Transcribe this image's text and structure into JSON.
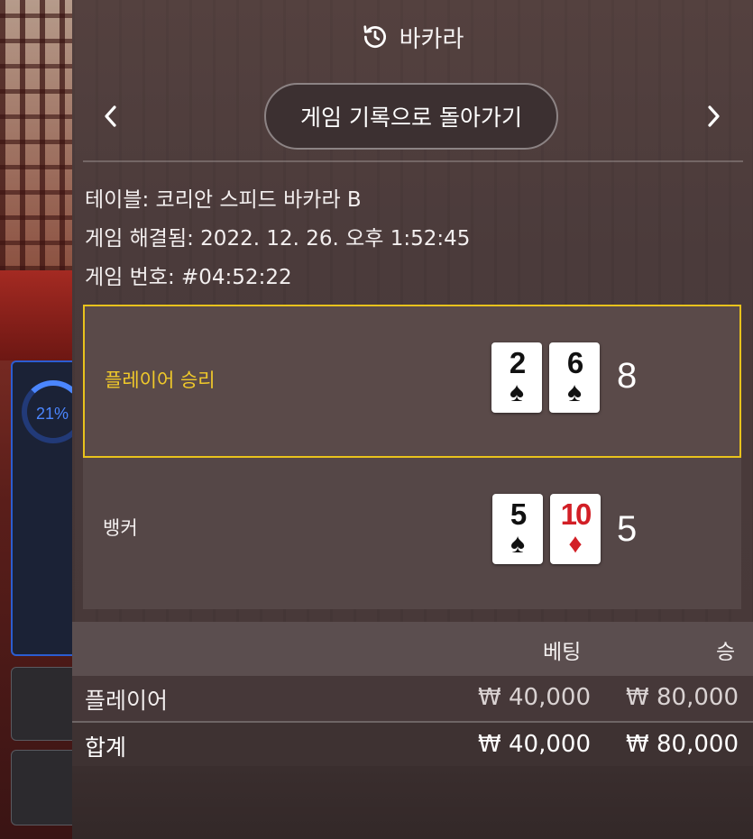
{
  "background": {
    "stat_percent": "21%"
  },
  "header": {
    "icon": "history-icon",
    "title": "바카라"
  },
  "nav": {
    "prev_icon": "chevron-left-icon",
    "next_icon": "chevron-right-icon",
    "back_label": "게임 기록으로 돌아가기"
  },
  "info": {
    "table": "테이블: 코리안 스피드 바카라 B",
    "resolved": "게임 해결됨: 2022. 12. 26. 오후 1:52:45",
    "round": "게임 번호: #04:52:22"
  },
  "results": {
    "player": {
      "label": "플레이어 승리",
      "cards": [
        {
          "rank": "2",
          "suit": "♠",
          "color": "black"
        },
        {
          "rank": "6",
          "suit": "♠",
          "color": "black"
        }
      ],
      "score": "8"
    },
    "banker": {
      "label": "뱅커",
      "cards": [
        {
          "rank": "5",
          "suit": "♠",
          "color": "black"
        },
        {
          "rank": "10",
          "suit": "♦",
          "color": "red"
        }
      ],
      "score": "5"
    }
  },
  "bets": {
    "headers": {
      "bet": "베팅",
      "win": "승"
    },
    "rows": [
      {
        "label": "플레이어",
        "bet": "₩ 40,000",
        "win": "₩ 80,000"
      }
    ],
    "total": {
      "label": "합계",
      "bet": "₩ 40,000",
      "win": "₩ 80,000"
    }
  },
  "colors": {
    "winner_accent": "#e8c21c",
    "red_suit": "#d21f26",
    "stat_blue": "#4b86ff"
  }
}
